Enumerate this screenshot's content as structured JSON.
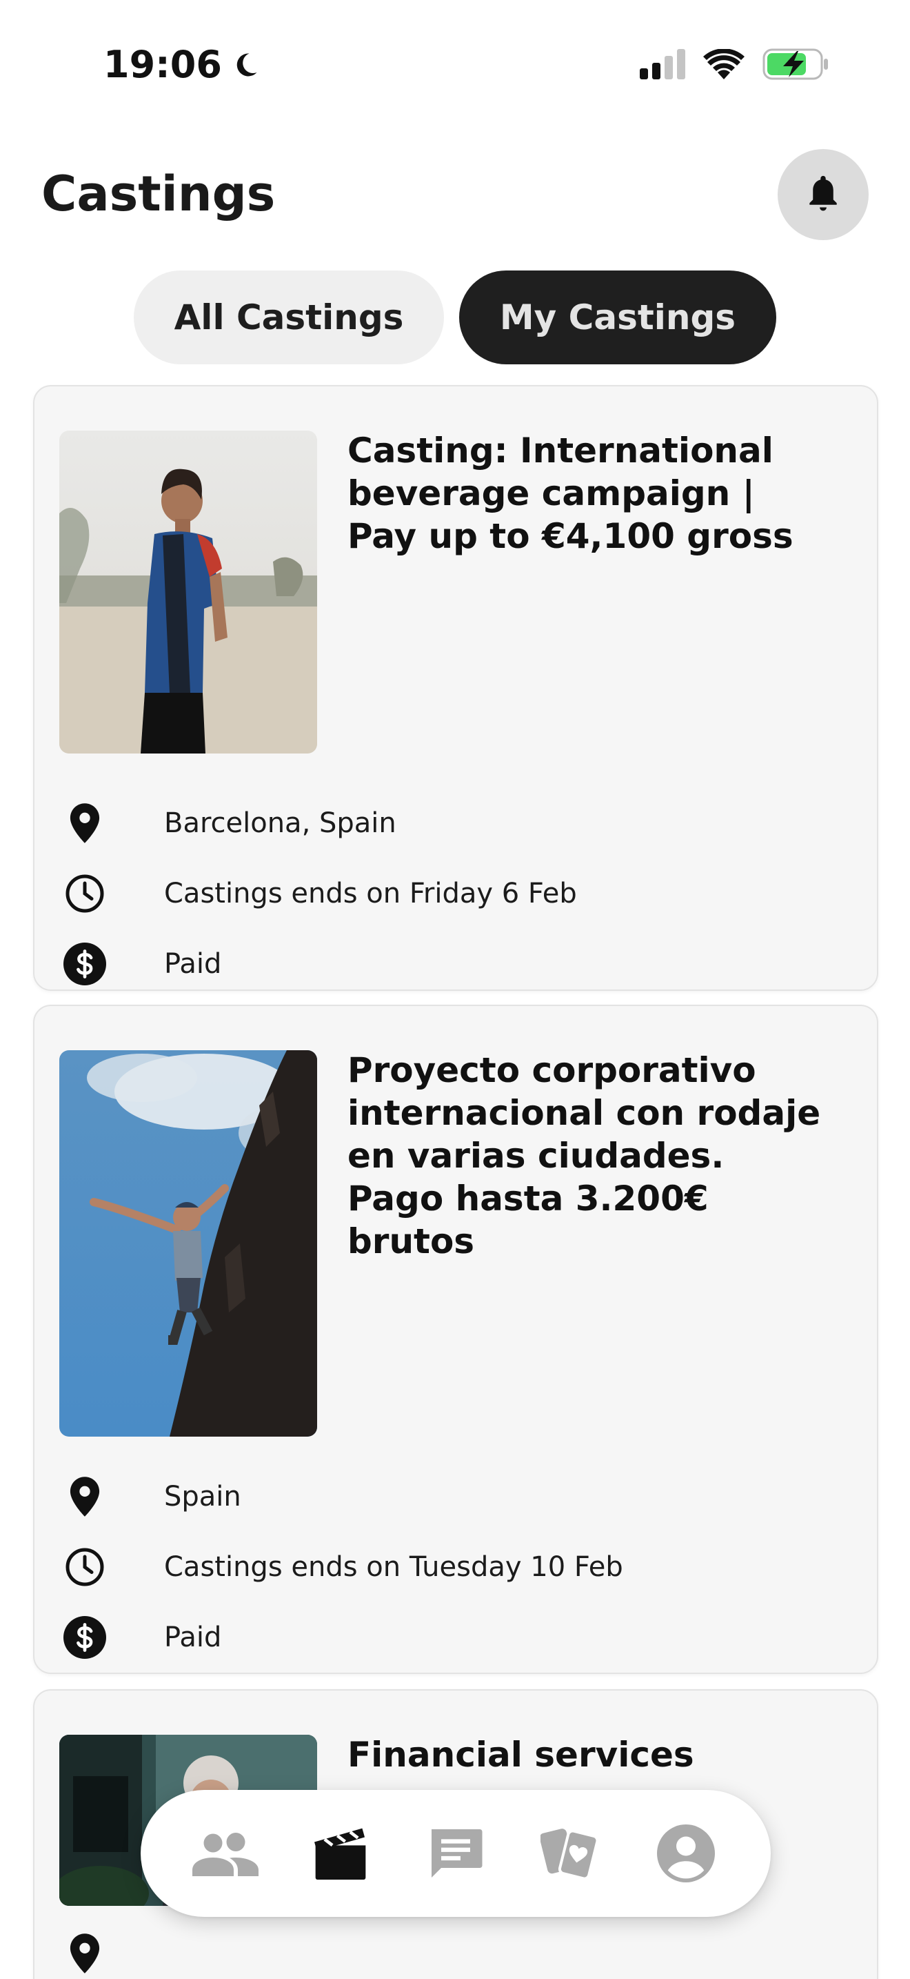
{
  "status_bar": {
    "time": "19:06"
  },
  "header": {
    "title": "Castings"
  },
  "tabs": [
    {
      "label": "All Castings",
      "active": false
    },
    {
      "label": "My Castings",
      "active": true
    }
  ],
  "castings": [
    {
      "title": "Casting: International beverage campaign | Pay up to €4,100 gross",
      "location": "Barcelona, Spain",
      "ends": "Castings ends on Friday 6 Feb",
      "payment": "Paid"
    },
    {
      "title": "Proyecto corporativo internacional con rodaje en varias ciudades. Pago hasta 3.200€ brutos",
      "location": "Spain",
      "ends": "Castings ends on Tuesday 10 Feb",
      "payment": "Paid"
    },
    {
      "title": "Financial services"
    }
  ],
  "bottom_nav": [
    {
      "icon": "people-icon",
      "active": false
    },
    {
      "icon": "clapperboard-icon",
      "active": true
    },
    {
      "icon": "chat-icon",
      "active": false
    },
    {
      "icon": "cards-icon",
      "active": false
    },
    {
      "icon": "profile-icon",
      "active": false
    }
  ],
  "colors": {
    "active_tab_bg": "#1f1f1f",
    "inactive_tab_bg": "#efefef",
    "card_bg": "#f6f6f6",
    "battery_green": "#4cd964"
  }
}
